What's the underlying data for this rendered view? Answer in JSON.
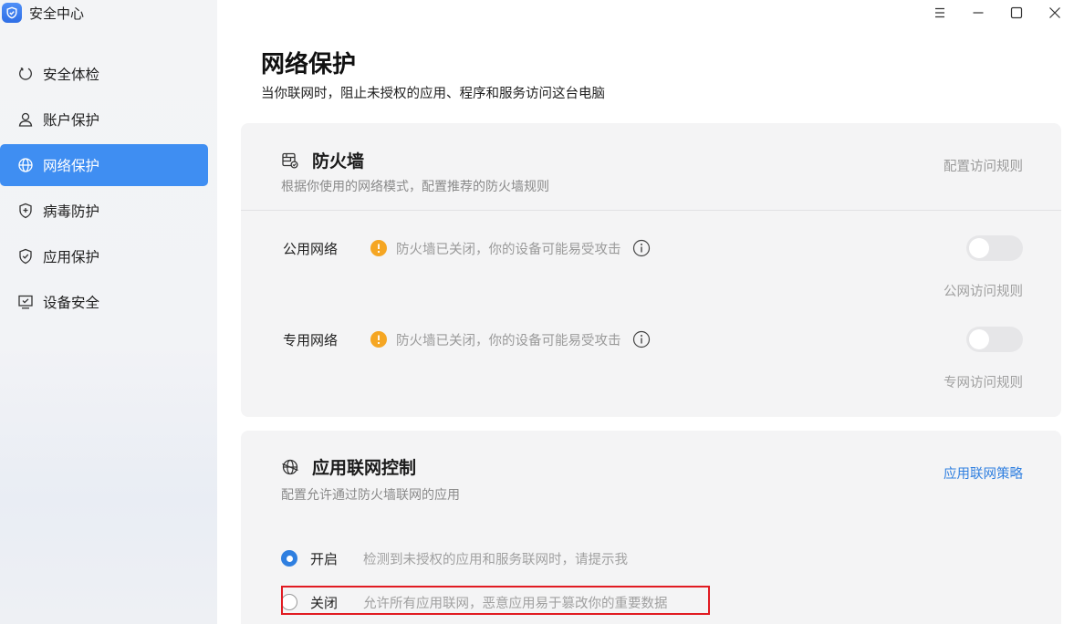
{
  "app": {
    "title": "安全中心",
    "icon": "shield-logo-icon",
    "accent": "#3f8ef2"
  },
  "window_controls": {
    "menu_icon": "menu-icon",
    "minimize_icon": "minimize-icon",
    "maximize_icon": "maximize-icon",
    "close_icon": "close-icon"
  },
  "sidebar": {
    "items": [
      {
        "label": "安全体检",
        "icon": "power-cycle-icon",
        "active": false
      },
      {
        "label": "账户保护",
        "icon": "user-icon",
        "active": false
      },
      {
        "label": "网络保护",
        "icon": "globe-icon",
        "active": true
      },
      {
        "label": "病毒防护",
        "icon": "shield-plus-icon",
        "active": false
      },
      {
        "label": "应用保护",
        "icon": "shield-check-icon",
        "active": false
      },
      {
        "label": "设备安全",
        "icon": "monitor-check-icon",
        "active": false
      }
    ]
  },
  "main": {
    "title": "网络保护",
    "subtitle": "当你联网时，阻止未授权的应用、程序和服务访问这台电脑",
    "firewall": {
      "icon": "firewall-icon",
      "title": "防火墙",
      "description": "根据你使用的网络模式，配置推荐的防火墙规则",
      "config_link": "配置访问规则",
      "networks": [
        {
          "label": "公用网络",
          "status": "防火墙已关闭，你的设备可能易受攻击",
          "enabled": false,
          "rules_link": "公网访问规则"
        },
        {
          "label": "专用网络",
          "status": "防火墙已关闭，你的设备可能易受攻击",
          "enabled": false,
          "rules_link": "专网访问规则"
        }
      ]
    },
    "app_network": {
      "icon": "app-network-icon",
      "title": "应用联网控制",
      "description": "配置允许通过防火墙联网的应用",
      "policy_link": "应用联网策略",
      "options": [
        {
          "label": "开启",
          "description": "检测到未授权的应用和服务联网时，请提示我",
          "checked": true
        },
        {
          "label": "关闭",
          "description": "允许所有应用联网，恶意应用易于篡改你的重要数据",
          "checked": false
        }
      ]
    }
  },
  "colors": {
    "link_blue": "#2f7fe0",
    "warning": "#f5a623",
    "highlight_red": "#e11b22"
  }
}
